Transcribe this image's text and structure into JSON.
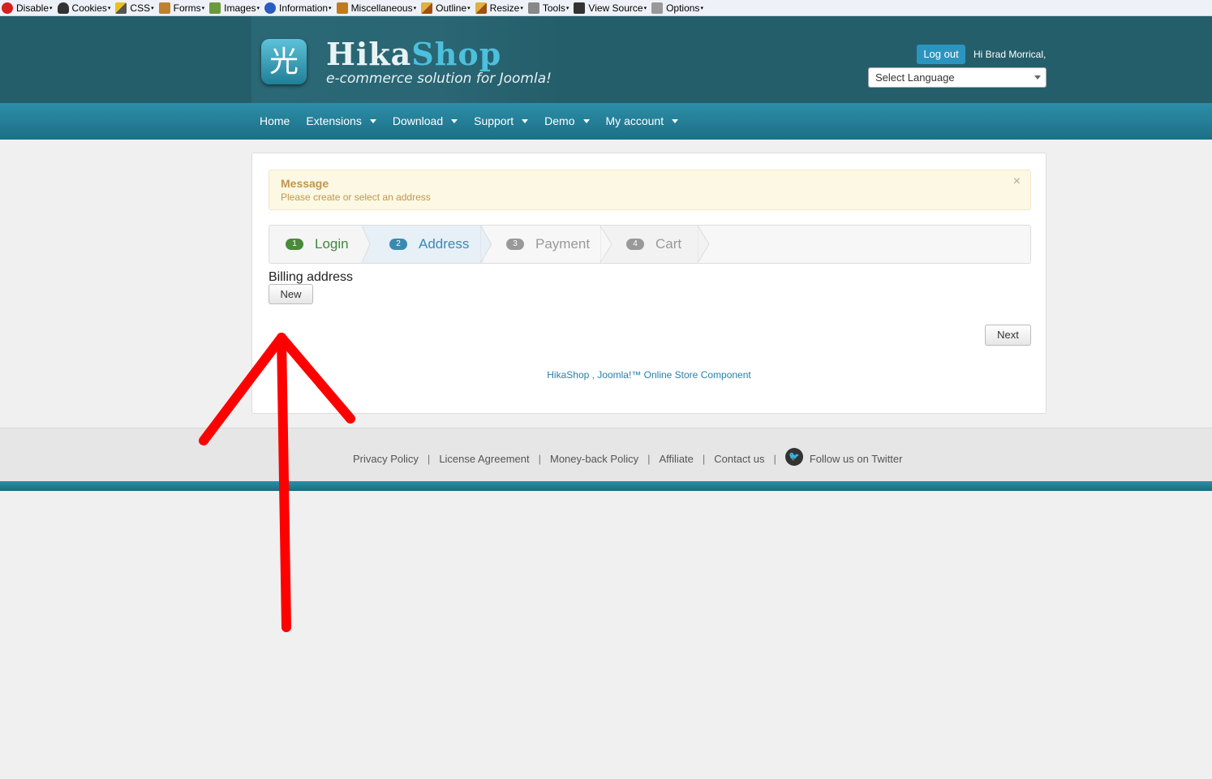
{
  "devbar": {
    "items": [
      "Disable",
      "Cookies",
      "CSS",
      "Forms",
      "Images",
      "Information",
      "Miscellaneous",
      "Outline",
      "Resize",
      "Tools",
      "View Source",
      "Options"
    ]
  },
  "header": {
    "logo_glyph": "光",
    "logo_hika": "Hika",
    "logo_shop": "Shop",
    "tagline": "e-commerce solution for Joomla!",
    "logout_label": "Log out",
    "greeting": "Hi Brad Morrical,",
    "language_select": "Select Language"
  },
  "nav": {
    "items": [
      {
        "label": "Home",
        "dropdown": false
      },
      {
        "label": "Extensions",
        "dropdown": true
      },
      {
        "label": "Download",
        "dropdown": true
      },
      {
        "label": "Support",
        "dropdown": true
      },
      {
        "label": "Demo",
        "dropdown": true
      },
      {
        "label": "My account",
        "dropdown": true
      }
    ]
  },
  "message": {
    "title": "Message",
    "text": "Please create or select an address",
    "close": "×"
  },
  "steps": [
    {
      "num": "1",
      "label": "Login",
      "state": "done"
    },
    {
      "num": "2",
      "label": "Address",
      "state": "active"
    },
    {
      "num": "3",
      "label": "Payment",
      "state": "todo"
    },
    {
      "num": "4",
      "label": "Cart",
      "state": "todo"
    }
  ],
  "billing": {
    "label": "Billing address",
    "new_button": "New"
  },
  "next_button": "Next",
  "credit": "HikaShop , Joomla!™ Online Store Component",
  "footer": {
    "links": [
      "Privacy Policy",
      "License Agreement",
      "Money-back Policy",
      "Affiliate",
      "Contact us"
    ],
    "twitter": "Follow us on Twitter",
    "separator": "|"
  },
  "colors": {
    "header": "#255e6b",
    "nav": "#2c8ea8",
    "annotation_arrow": "#ff0000"
  }
}
